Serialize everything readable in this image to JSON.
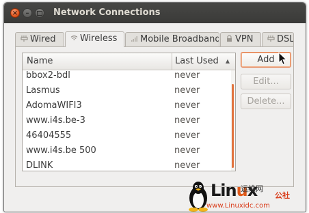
{
  "window": {
    "title": "Network Connections"
  },
  "tabs": [
    {
      "label": "Wired",
      "icon": "wired-icon",
      "active": false
    },
    {
      "label": "Wireless",
      "icon": "wireless-icon",
      "active": true
    },
    {
      "label": "Mobile Broadband",
      "icon": "mobile-broadband-icon",
      "active": false
    },
    {
      "label": "VPN",
      "icon": "vpn-icon",
      "active": false
    },
    {
      "label": "DSL",
      "icon": "dsl-icon",
      "active": false
    }
  ],
  "list": {
    "columns": {
      "name": "Name",
      "last_used": "Last Used"
    },
    "sort_indicator": "▲",
    "rows": [
      {
        "name": "bbox2-bdl",
        "last_used": "never"
      },
      {
        "name": "Lasmus",
        "last_used": "never"
      },
      {
        "name": "AdomaWIFI3",
        "last_used": "never"
      },
      {
        "name": "www.i4s.be-3",
        "last_used": "never"
      },
      {
        "name": "46404555",
        "last_used": "never"
      },
      {
        "name": "www.i4s.be 500",
        "last_used": "never"
      },
      {
        "name": "DLINK",
        "last_used": "never"
      }
    ]
  },
  "buttons": {
    "add": "Add",
    "edit": "Edit...",
    "delete": "Delete..."
  },
  "watermark": {
    "brand_left": "Lin",
    "brand_u": "u",
    "brand_right": "x",
    "site_cn": "公社",
    "sub_cn": "运维网",
    "url": "www.Linuxidc.com"
  },
  "colors": {
    "titlebar": "#3c3b37",
    "accent": "#e2743f",
    "close": "#e2561d"
  }
}
